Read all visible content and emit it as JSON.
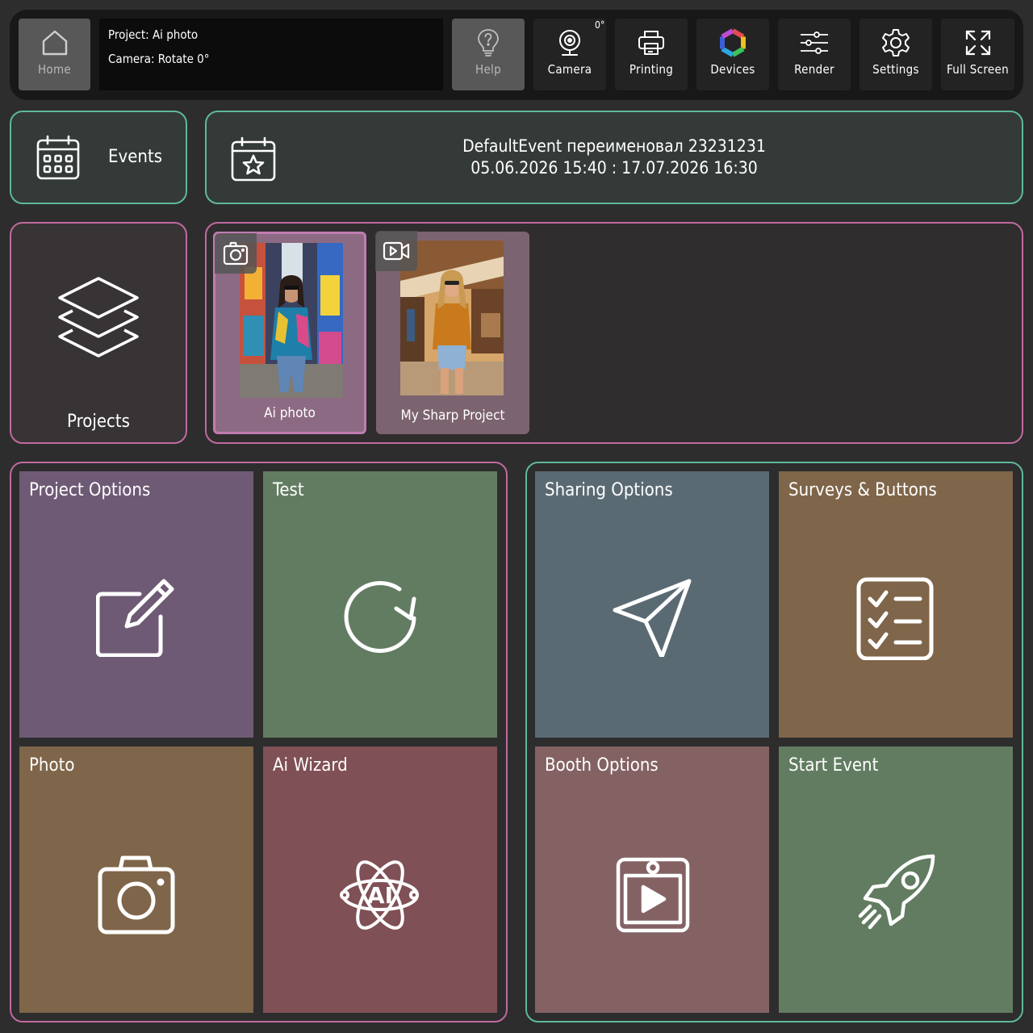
{
  "toolbar": {
    "home_label": "Home",
    "project_line": "Project: Ai photo",
    "camera_line": "Camera: Rotate 0°",
    "help_label": "Help",
    "camera_label": "Camera",
    "camera_rotation": "0°",
    "printing_label": "Printing",
    "devices_label": "Devices",
    "render_label": "Render",
    "settings_label": "Settings",
    "fullscreen_label": "Full Screen"
  },
  "events": {
    "label": "Events",
    "current_event_name": "DefaultEvent переименовал 23231231",
    "current_event_dates": "05.06.2026 15:40 : 17.07.2026 16:30"
  },
  "projects": {
    "label": "Projects",
    "items": [
      {
        "name": "Ai photo",
        "type_icon": "camera-icon",
        "selected": true
      },
      {
        "name": "My Sharp Project",
        "type_icon": "video-camera-icon",
        "selected": false
      }
    ]
  },
  "tiles": {
    "project_options": "Project Options",
    "test": "Test",
    "photo": "Photo",
    "ai_wizard": "Ai Wizard",
    "sharing_options": "Sharing Options",
    "surveys_buttons": "Surveys & Buttons",
    "booth_options": "Booth Options",
    "start_event": "Start Event"
  },
  "colors": {
    "background": "#2d2d2d",
    "teal_outline": "#5fb89a",
    "pink_outline": "#c06aa0",
    "tile_purple": "#6f5a75",
    "tile_green": "#627c61",
    "tile_slate": "#5a6a73",
    "tile_brown": "#7f6549",
    "tile_red": "#7f5055",
    "tile_rose": "#846264"
  }
}
